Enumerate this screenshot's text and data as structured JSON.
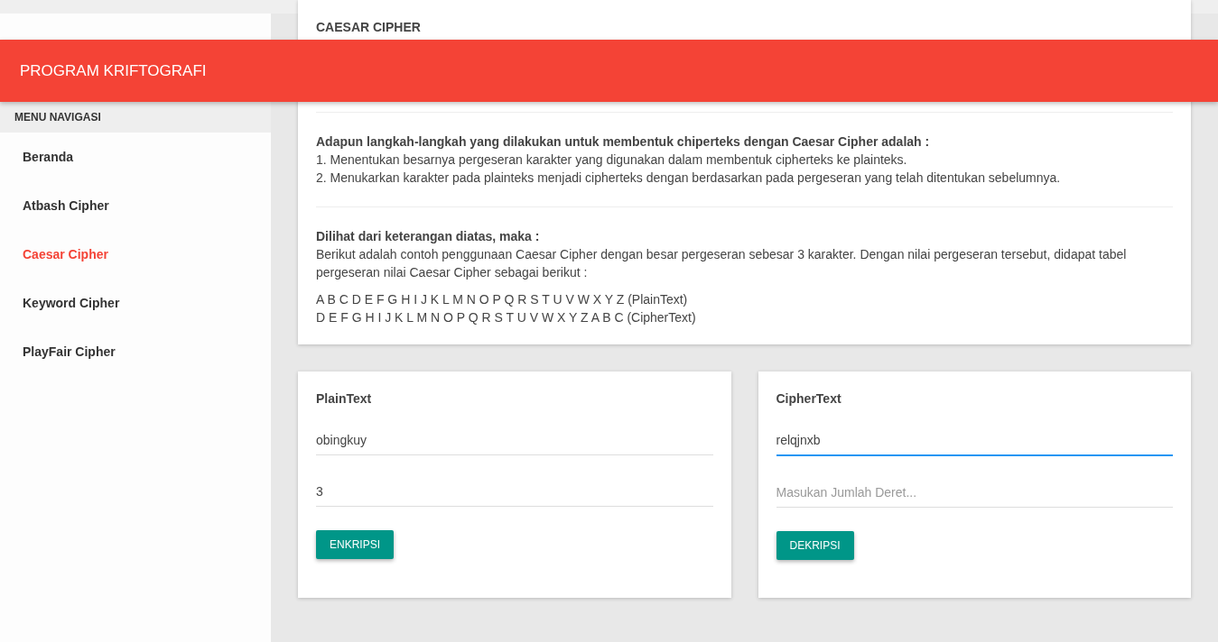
{
  "header": {
    "title": "PROGRAM KRIFTOGRAFI"
  },
  "sidebar": {
    "heading": "MENU NAVIGASI",
    "items": [
      {
        "label": "Beranda",
        "selected": false
      },
      {
        "label": "Atbash Cipher",
        "selected": false
      },
      {
        "label": "Caesar Cipher",
        "selected": true
      },
      {
        "label": "Keyword Cipher",
        "selected": false
      },
      {
        "label": "PlayFair Cipher",
        "selected": false
      }
    ]
  },
  "info_card": {
    "title": "CAESAR CIPHER",
    "sections": [
      {
        "heading": "Adapun langkah-langkah yang dilakukan untuk membentuk chiperteks dengan Caesar Cipher adalah :",
        "lines": [
          "1. Menentukan besarnya pergeseran karakter yang digunakan dalam membentuk cipherteks ke plainteks.",
          "2. Menukarkan karakter pada plainteks menjadi cipherteks dengan berdasarkan pada pergeseran yang telah ditentukan sebelumnya."
        ]
      },
      {
        "heading": "Dilihat dari keterangan diatas, maka :",
        "lines": [
          "Berikut adalah contoh penggunaan Caesar Cipher dengan besar pergeseran sebesar 3 karakter. Dengan nilai pergeseran tersebut, didapat tabel pergeseran nilai Caesar Cipher sebagai berikut :"
        ],
        "table_lines": [
          "A B C D E F G H I J K L M N O P Q R S T U V W X Y Z (PlainText)",
          "D E F G H I J K L M N O P Q R S T U V W X Y Z A B C (CipherText)"
        ]
      }
    ]
  },
  "forms": [
    {
      "title": "PlainText",
      "fields": [
        {
          "value": "obingkuy",
          "focused": false
        },
        {
          "value": "3",
          "focused": false
        }
      ],
      "button": "ENKRIPSI"
    },
    {
      "title": "CipherText",
      "fields": [
        {
          "value": "relqjnxb",
          "focused": true
        },
        {
          "placeholder": "Masukan Jumlah Deret...",
          "focused": false
        }
      ],
      "button": "DEKRIPSI"
    }
  ]
}
